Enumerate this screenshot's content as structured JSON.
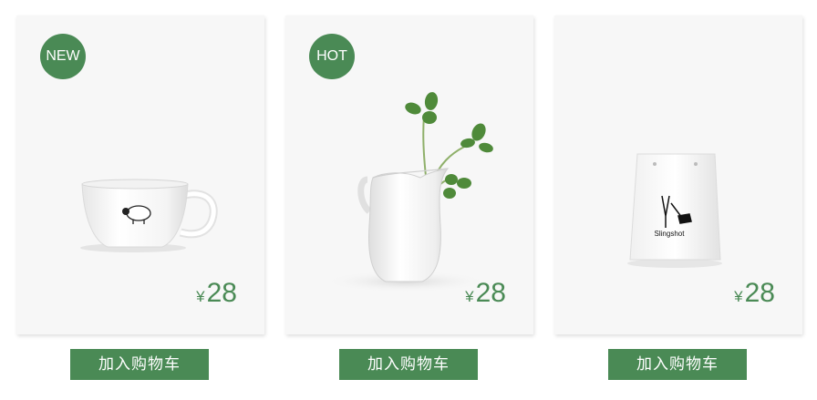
{
  "products": [
    {
      "badge": "NEW",
      "image": "white-cup-with-sheep-icon",
      "currency": "¥",
      "price": "28",
      "button_label": "加入购物车"
    },
    {
      "badge": "HOT",
      "image": "white-pitcher-with-clover-icon",
      "currency": "¥",
      "price": "28",
      "button_label": "加入购物车"
    },
    {
      "badge": "",
      "image": "white-bag-slingshot-icon",
      "bag_text": "Slingshot",
      "currency": "¥",
      "price": "28",
      "button_label": "加入购物车"
    }
  ],
  "colors": {
    "accent": "#4a8a55",
    "card_bg": "#f7f7f7"
  }
}
